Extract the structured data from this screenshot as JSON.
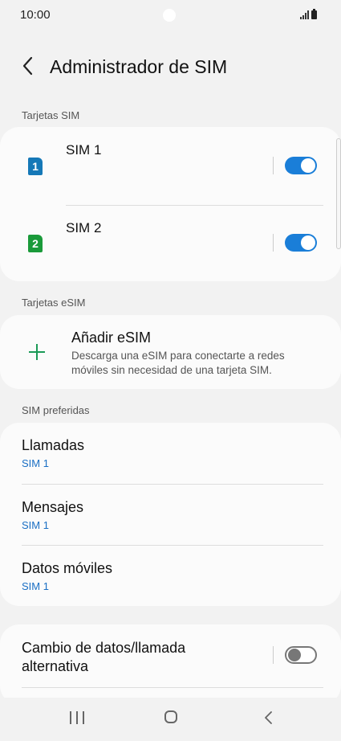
{
  "status_bar": {
    "time": "10:00"
  },
  "header": {
    "title": "Administrador de SIM"
  },
  "sections": {
    "sim_cards": "Tarjetas SIM",
    "esim": "Tarjetas eSIM",
    "preferred": "SIM preferidas"
  },
  "sims": [
    {
      "badge": "1",
      "name": "SIM 1",
      "enabled": true,
      "color": "#1578b7"
    },
    {
      "badge": "2",
      "name": "SIM 2",
      "enabled": true,
      "color": "#1a9a3a"
    }
  ],
  "esim": {
    "title": "Añadir eSIM",
    "description": "Descarga una eSIM para conectarte a redes móviles sin necesidad de una tarjeta SIM."
  },
  "preferred": [
    {
      "title": "Llamadas",
      "value": "SIM 1"
    },
    {
      "title": "Mensajes",
      "value": "SIM 1"
    },
    {
      "title": "Datos móviles",
      "value": "SIM 1"
    }
  ],
  "data_switch": {
    "title": "Cambio de datos/llamada alternativa",
    "enabled": false
  },
  "colors": {
    "accent": "#1a7ed8",
    "plus": "#1b9a57",
    "link": "#1a6fc4"
  },
  "nav_icons": [
    "recents-icon",
    "home-icon",
    "back-icon"
  ]
}
